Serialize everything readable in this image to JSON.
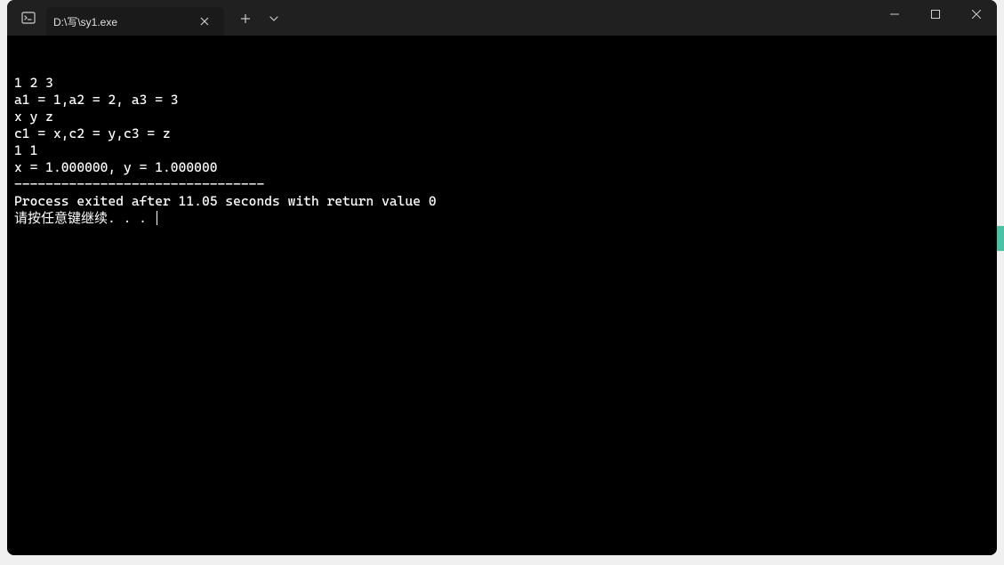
{
  "window": {
    "title": "D:\\写\\sy1.exe"
  },
  "terminal": {
    "lines": [
      "1 2 3",
      "a1 = 1,a2 = 2, a3 = 3",
      "x y z",
      "c1 = x,c2 = y,c3 = z",
      "1 1",
      "x = 1.000000, y = 1.000000",
      "",
      "--------------------------------",
      "Process exited after 11.05 seconds with return value 0",
      "请按任意键继续. . . "
    ]
  }
}
